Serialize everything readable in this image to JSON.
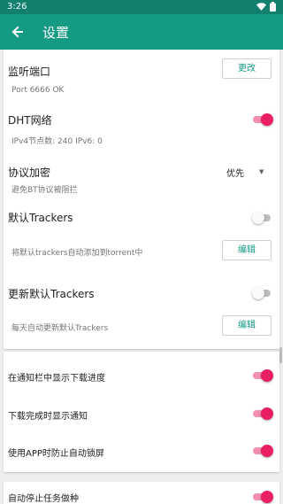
{
  "statusbar": {
    "time": "3:26"
  },
  "appbar": {
    "title": "设置"
  },
  "settings": {
    "listen_port": {
      "label": "监听端口",
      "status": "Port  6666 OK",
      "button": "更改"
    },
    "dht": {
      "label": "DHT网络",
      "status": "IPv4节点数: 240 IPv6:  0",
      "enabled": true
    },
    "encryption": {
      "label": "协议加密",
      "value": "优先",
      "desc": "避免BT协议被阻拦"
    },
    "default_trackers": {
      "label": "默认Trackers",
      "desc": "将默认trackers自动添加到torrent中",
      "button": "编辑",
      "enabled": false
    },
    "update_trackers": {
      "label": "更新默认Trackers",
      "desc": "每天自动更新默认Trackers",
      "button": "编辑",
      "enabled": false
    },
    "notify_progress": {
      "label": "在通知栏中显示下载进度",
      "enabled": true
    },
    "notify_complete": {
      "label": "下载完成时显示通知",
      "enabled": true
    },
    "keep_screen": {
      "label": "使用APP时防止自动锁屏",
      "enabled": true
    },
    "auto_stop_seeding": {
      "label": "自动停止任务做种",
      "enabled": true
    }
  },
  "colors": {
    "statusbar": "#11806d",
    "appbar": "#159a84",
    "accent": "#e91e63"
  }
}
